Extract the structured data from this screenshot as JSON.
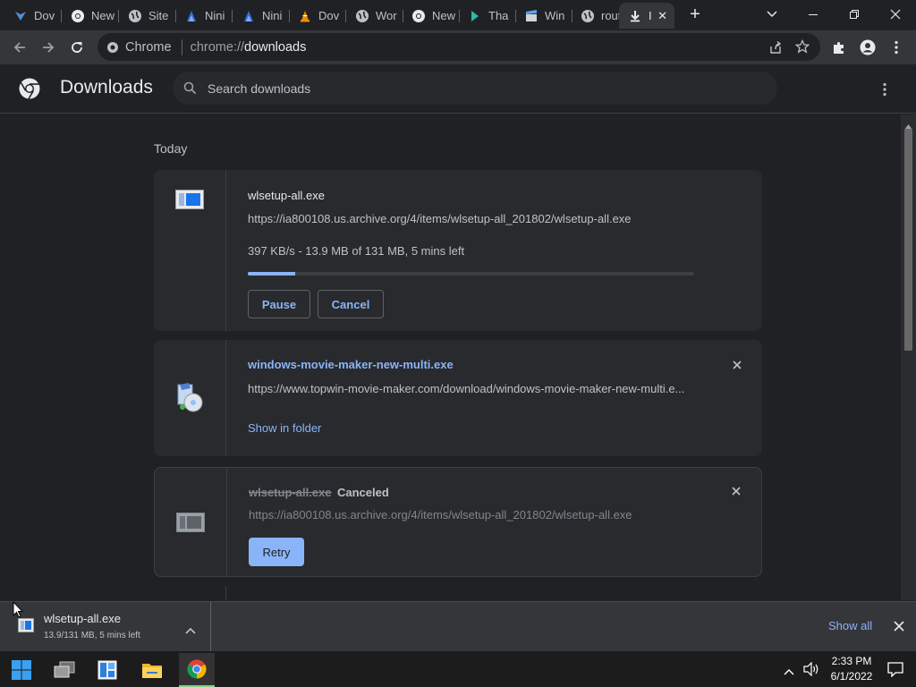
{
  "browser": {
    "tabs": [
      {
        "label": "Dov",
        "icon": "bitwarden-favicon-icon"
      },
      {
        "label": "New",
        "icon": "chrome-favicon-icon"
      },
      {
        "label": "Site",
        "icon": "globe-favicon-icon"
      },
      {
        "label": "Nini",
        "icon": "ninite-favicon-icon"
      },
      {
        "label": "Nini",
        "icon": "ninite-favicon-icon"
      },
      {
        "label": "Dov",
        "icon": "vlc-favicon-icon"
      },
      {
        "label": "Wor",
        "icon": "globe-favicon-icon"
      },
      {
        "label": "New",
        "icon": "chrome-favicon-icon"
      },
      {
        "label": "Tha",
        "icon": "arrow-favicon-icon"
      },
      {
        "label": "Win",
        "icon": "clapper-favicon-icon"
      },
      {
        "label": "rout",
        "icon": "globe-favicon-icon"
      },
      {
        "label": "I",
        "icon": "download-icon",
        "active": true
      }
    ],
    "omnibox": {
      "site_label": "Chrome",
      "scheme": "chrome://",
      "host": "downloads"
    }
  },
  "page": {
    "title": "Downloads",
    "search": {
      "placeholder": "Search downloads"
    },
    "group_label": "Today",
    "items": [
      {
        "filename": "wlsetup-all.exe",
        "url": "https://ia800108.us.archive.org/4/items/wlsetup-all_201802/wlsetup-all.exe",
        "status": "397 KB/s - 13.9 MB of 131 MB, 5 mins left",
        "progress_fraction": 0.106,
        "pause_label": "Pause",
        "cancel_label": "Cancel"
      },
      {
        "filename": "windows-movie-maker-new-multi.exe",
        "url": "https://www.topwin-movie-maker.com/download/windows-movie-maker-new-multi.e...",
        "show_in_folder_label": "Show in folder"
      },
      {
        "filename": "wlsetup-all.exe",
        "state_label": "Canceled",
        "url": "https://ia800108.us.archive.org/4/items/wlsetup-all_201802/wlsetup-all.exe",
        "retry_label": "Retry"
      }
    ]
  },
  "shelf": {
    "item_name": "wlsetup-all.exe",
    "item_status": "13.9/131 MB, 5 mins left",
    "show_all_label": "Show all"
  },
  "taskbar": {
    "time": "2:33 PM",
    "date": "6/1/2022",
    "apps": [
      "start-icon",
      "task-view-icon",
      "widgets-icon",
      "file-explorer-icon",
      "chrome-icon"
    ]
  },
  "colors": {
    "accent": "#8ab4f8",
    "background": "#202124",
    "card": "#292a2d"
  }
}
